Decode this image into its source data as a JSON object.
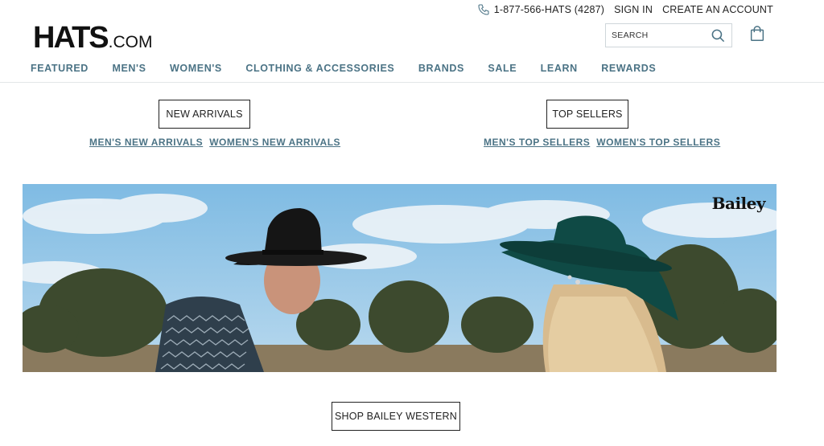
{
  "utility": {
    "phone": "1-877-566-HATS (4287)",
    "sign_in": "SIGN IN",
    "create_account": "CREATE AN ACCOUNT"
  },
  "logo": {
    "main": "HATS",
    "suffix": ".COM"
  },
  "search": {
    "placeholder": "SEARCH"
  },
  "nav": {
    "items": [
      "FEATURED",
      "MEN'S",
      "WOMEN'S",
      "CLOTHING & ACCESSORIES",
      "BRANDS",
      "SALE",
      "LEARN",
      "REWARDS"
    ]
  },
  "promo": {
    "new_arrivals": {
      "button": "NEW ARRIVALS",
      "links": [
        "MEN'S NEW ARRIVALS",
        "WOMEN'S NEW ARRIVALS"
      ]
    },
    "top_sellers": {
      "button": "TOP SELLERS",
      "links": [
        "MEN'S TOP SELLERS",
        "WOMEN'S TOP SELLERS"
      ]
    }
  },
  "hero": {
    "brand": "Bailey"
  },
  "cta": {
    "label": "SHOP BAILEY WESTERN"
  },
  "colors": {
    "nav_accent": "#4b7385",
    "sky": "#8ec3e6",
    "hat_green": "#0f4a45"
  },
  "icons": {
    "phone": "phone-icon",
    "search": "search-icon",
    "cart": "shopping-bag-icon"
  }
}
